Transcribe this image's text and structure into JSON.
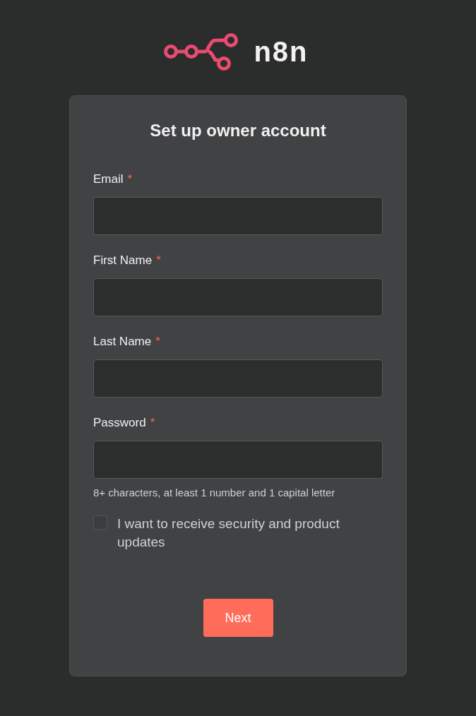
{
  "logo": {
    "wordmark": "n8n"
  },
  "card": {
    "title": "Set up owner account",
    "fields": [
      {
        "label": "Email",
        "required_mark": "*"
      },
      {
        "label": "First Name",
        "required_mark": "*"
      },
      {
        "label": "Last Name",
        "required_mark": "*"
      },
      {
        "label": "Password",
        "required_mark": "*",
        "hint": "8+ characters, at least 1 number and 1 capital letter"
      }
    ],
    "checkbox": {
      "label": "I want to receive security and product updates",
      "checked": false
    },
    "button": {
      "label": "Next"
    }
  }
}
